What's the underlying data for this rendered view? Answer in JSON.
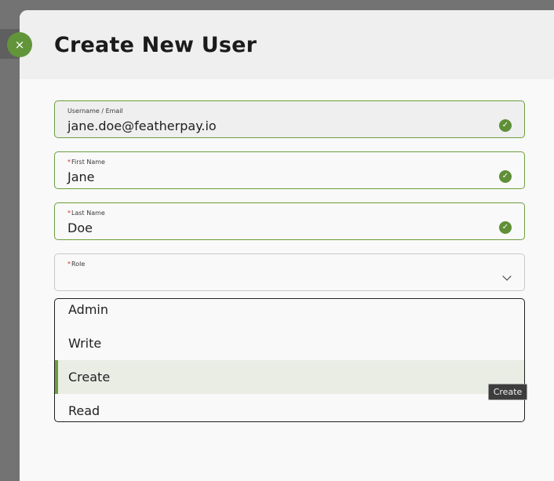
{
  "modal": {
    "title": "Create New User",
    "close_icon": "×",
    "accent_color": "#62953a"
  },
  "form": {
    "username": {
      "label": "Username / Email",
      "value": "jane.doe@featherpay.io",
      "valid": true
    },
    "first_name": {
      "label": "First Name",
      "required_mark": "*",
      "value": "Jane",
      "valid": true
    },
    "last_name": {
      "label": "Last Name",
      "required_mark": "*",
      "value": "Doe",
      "valid": true
    },
    "role": {
      "label": "Role",
      "required_mark": "*",
      "value": ""
    }
  },
  "role_dropdown": {
    "options": [
      "Admin",
      "Write",
      "Create",
      "Read"
    ],
    "highlighted": "Create"
  },
  "tooltip": {
    "text": "Create"
  },
  "icons": {
    "check": "✓",
    "close": "close-icon",
    "chevron": "chevron-down-icon"
  }
}
